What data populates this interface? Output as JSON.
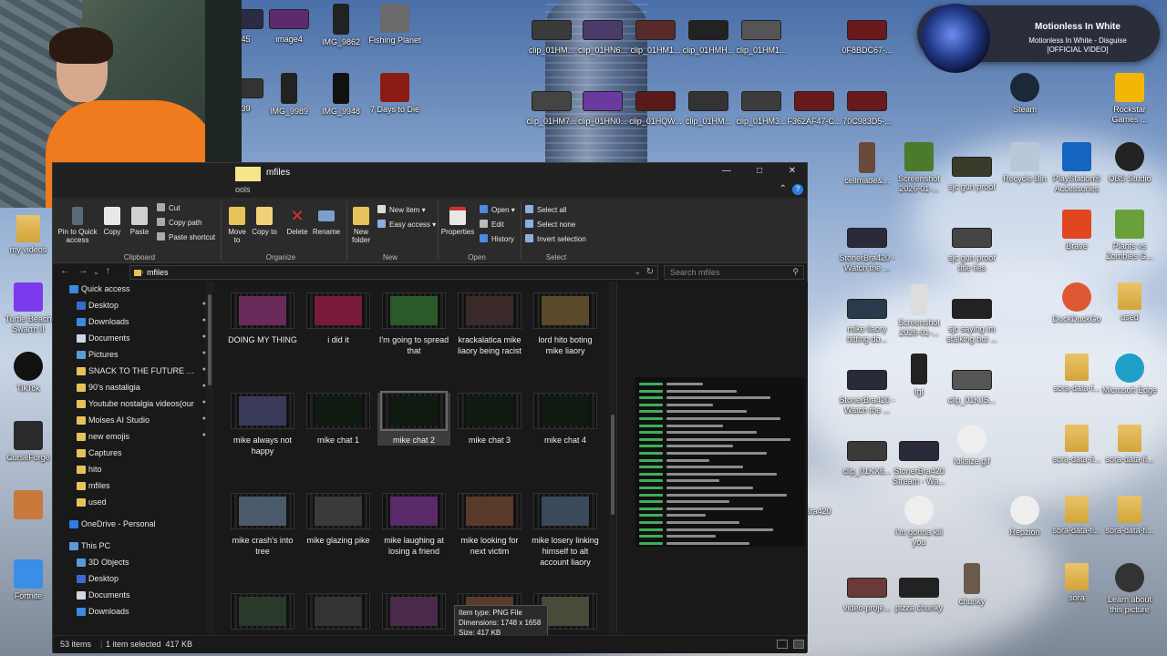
{
  "desktop_icons": [
    {
      "label": "945",
      "kind": "wide",
      "color": "#2b2b44"
    },
    {
      "label": "image4",
      "kind": "wide",
      "color": "#5e2a6e"
    },
    {
      "label": "IMG_9862",
      "kind": "tall",
      "color": "#222"
    },
    {
      "label": "Fishing Planet",
      "kind": "square",
      "color": "#6a6a6a"
    },
    {
      "label": "039",
      "kind": "wide",
      "color": "#333"
    },
    {
      "label": "IMG_9989",
      "kind": "tall",
      "color": "#222"
    },
    {
      "label": "IMG_9948",
      "kind": "tall",
      "color": "#111"
    },
    {
      "label": "7 Days to Die",
      "kind": "square",
      "color": "#8a1c14"
    },
    {
      "label": "clip_01HM...",
      "kind": "wide",
      "color": "#3a3a3a"
    },
    {
      "label": "clip_01HN6...",
      "kind": "wide",
      "color": "#4b3b6a"
    },
    {
      "label": "clip_01HM1...",
      "kind": "wide",
      "color": "#5a2a2a"
    },
    {
      "label": "clip_01HMH...",
      "kind": "wide",
      "color": "#222"
    },
    {
      "label": "clip_01HM1...",
      "kind": "wide",
      "color": "#555"
    },
    {
      "label": "0F8BDC67-...",
      "kind": "wide",
      "color": "#6a1a1a"
    },
    {
      "label": "clip_01HM7...",
      "kind": "wide",
      "color": "#444"
    },
    {
      "label": "clip_01HN0...",
      "kind": "wide",
      "color": "#6a3aa0"
    },
    {
      "label": "clip_01HQW...",
      "kind": "wide",
      "color": "#5a1a1a"
    },
    {
      "label": "clip_01HM...",
      "kind": "wide",
      "color": "#333"
    },
    {
      "label": "clip_01HM3...",
      "kind": "wide",
      "color": "#3c3c3c"
    },
    {
      "label": "F362AF47-C...",
      "kind": "wide",
      "color": "#6a1a1a"
    },
    {
      "label": "70C983D5-...",
      "kind": "wide",
      "color": "#6a1a1a"
    },
    {
      "label": "Steam",
      "kind": "round",
      "color": "#1b2838"
    },
    {
      "label": "Rockstar Games ...",
      "kind": "square",
      "color": "#f2b705"
    },
    {
      "label": "cellmade&...",
      "kind": "tall",
      "color": "#6a4a3a"
    },
    {
      "label": "Screenshot 2026-01-...",
      "kind": "square",
      "color": "#4a7a2a"
    },
    {
      "label": "sjc gun proof",
      "kind": "wide",
      "color": "#3a3a2a"
    },
    {
      "label": "Recycle Bin",
      "kind": "square",
      "color": "#b8c8d8"
    },
    {
      "label": "PlayStation® Accessories",
      "kind": "square",
      "color": "#1565c0"
    },
    {
      "label": "OBS Studio",
      "kind": "round",
      "color": "#222"
    },
    {
      "label": "StonerBra420 - Watch the ...",
      "kind": "wide",
      "color": "#2a2a3a"
    },
    {
      "label": "sjc gun proof title fies",
      "kind": "wide",
      "color": "#444"
    },
    {
      "label": "Brave",
      "kind": "square",
      "color": "#e0461f"
    },
    {
      "label": "Plants vs Zombies G...",
      "kind": "square",
      "color": "#6aa03a"
    },
    {
      "label": "mike liaory hitting do...",
      "kind": "wide",
      "color": "#2a3a4a"
    },
    {
      "label": "Screenshot 2026-01-...",
      "kind": "tall",
      "color": "#ddd"
    },
    {
      "label": "sjc saying im stalking but ...",
      "kind": "wide",
      "color": "#222"
    },
    {
      "label": "DuckDuckGo",
      "kind": "round",
      "color": "#de5833"
    },
    {
      "label": "used",
      "kind": "folder",
      "color": "#e9c46a"
    },
    {
      "label": "StonerBra420 - Watch the ...",
      "kind": "wide",
      "color": "#2a2a3a"
    },
    {
      "label": "fgt",
      "kind": "tall",
      "color": "#222"
    },
    {
      "label": "clip_01KJS...",
      "kind": "wide",
      "color": "#555"
    },
    {
      "label": "sora-data-f...",
      "kind": "folder",
      "color": "#e9c46a"
    },
    {
      "label": "Microsoft Edge",
      "kind": "round",
      "color": "#1ea0c8"
    },
    {
      "label": "clip_01KX6...",
      "kind": "wide",
      "color": "#3a3a3a"
    },
    {
      "label": "StonerBra420 Stream - Wa...",
      "kind": "wide",
      "color": "#2a2a3a"
    },
    {
      "label": "fullsize.gif",
      "kind": "round",
      "color": "#eee"
    },
    {
      "label": "sora-data-fi...",
      "kind": "folder",
      "color": "#e9c46a"
    },
    {
      "label": "sora-data-fi...",
      "kind": "folder",
      "color": "#e9c46a"
    },
    {
      "label": "erBra420",
      "kind": "none",
      "color": "#333"
    },
    {
      "label": "I'm gonna kill you",
      "kind": "round",
      "color": "#eee"
    },
    {
      "label": "Repzion",
      "kind": "round",
      "color": "#eee"
    },
    {
      "label": "sora-data-fi...",
      "kind": "folder",
      "color": "#e9c46a"
    },
    {
      "label": "sora-data-fi...",
      "kind": "folder",
      "color": "#e9c46a"
    },
    {
      "label": "video-proje...",
      "kind": "wide",
      "color": "#6a3a3a"
    },
    {
      "label": "pizza chunky",
      "kind": "wide",
      "color": "#222"
    },
    {
      "label": "chunky",
      "kind": "tall",
      "color": "#6a5a4a"
    },
    {
      "label": "sora",
      "kind": "folder",
      "color": "#e9c46a"
    },
    {
      "label": "Learn about this picture",
      "kind": "round",
      "color": "#333"
    },
    {
      "label": "my videos",
      "kind": "folder",
      "color": "#e9c46a"
    },
    {
      "label": "Turtle Beach Swarm II",
      "kind": "square",
      "color": "#7c3aed"
    },
    {
      "label": "TikTok",
      "kind": "round",
      "color": "#111"
    },
    {
      "label": "CurseForge",
      "kind": "square",
      "color": "#2a2a2a"
    },
    {
      "label": "",
      "kind": "square",
      "color": "#c8783a"
    },
    {
      "label": "Fortnite",
      "kind": "square",
      "color": "#3a8ee6"
    }
  ],
  "now_playing": {
    "title": "Motionless In White",
    "subtitle_line1": "Motionless In White - Disguise",
    "subtitle_line2": "[OFFICIAL VIDEO]"
  },
  "explorer": {
    "title": "mfiles",
    "tools_tab": "ools",
    "ribbon": {
      "pin": "Pin to Quick access",
      "copy": "Copy",
      "paste": "Paste",
      "cut": "Cut",
      "copy_path": "Copy path",
      "paste_shortcut": "Paste shortcut",
      "clipboard": "Clipboard",
      "move_to": "Move to",
      "copy_to": "Copy to",
      "delete": "Delete",
      "rename": "Rename",
      "organize": "Organize",
      "new_folder": "New folder",
      "new_item": "New item",
      "easy_access": "Easy access",
      "new": "New",
      "properties": "Properties",
      "open": "Open",
      "edit": "Edit",
      "history": "History",
      "open_group": "Open",
      "select_all": "Select all",
      "select_none": "Select none",
      "invert_selection": "Invert selection",
      "select": "Select"
    },
    "address": "mfiles",
    "search_placeholder": "Search mfiles",
    "nav": [
      {
        "label": "Quick access",
        "pinned": false
      },
      {
        "label": "Desktop",
        "pinned": true
      },
      {
        "label": "Downloads",
        "pinned": true
      },
      {
        "label": "Documents",
        "pinned": true
      },
      {
        "label": "Pictures",
        "pinned": true
      },
      {
        "label": "SNACK TO THE FUTURE YOU1",
        "pinned": true
      },
      {
        "label": "90's nastaligia",
        "pinned": true
      },
      {
        "label": "Youtube nostalgia videos(our",
        "pinned": true
      },
      {
        "label": "Moises AI Studio",
        "pinned": true
      },
      {
        "label": "new emojis",
        "pinned": true
      },
      {
        "label": "Captures",
        "pinned": false
      },
      {
        "label": "hito",
        "pinned": false
      },
      {
        "label": "mfiles",
        "pinned": false
      },
      {
        "label": "used",
        "pinned": false
      },
      {
        "label": "OneDrive - Personal",
        "pinned": false
      },
      {
        "label": "This PC",
        "pinned": false
      },
      {
        "label": "3D Objects",
        "pinned": false
      },
      {
        "label": "Desktop",
        "pinned": false
      },
      {
        "label": "Documents",
        "pinned": false
      },
      {
        "label": "Downloads",
        "pinned": false
      }
    ],
    "files": [
      {
        "label": "DOING MY THING",
        "color": "#6a2a5a"
      },
      {
        "label": "i did it",
        "color": "#7a1a3a"
      },
      {
        "label": "I'm going to spread that",
        "color": "#2a5a2a"
      },
      {
        "label": "krackalatica mike liaory being racist",
        "color": "#3a2a2a"
      },
      {
        "label": "lord hito boting mike liaory",
        "color": "#5a4a2a"
      },
      {
        "label": "mike always not happy",
        "color": "#3a3a5a"
      },
      {
        "label": "mike chat 1",
        "color": "#0f1a10"
      },
      {
        "label": "mike chat 2",
        "color": "#0f1a10"
      },
      {
        "label": "mike chat 3",
        "color": "#0f1a10"
      },
      {
        "label": "mike chat 4",
        "color": "#0f1a10"
      },
      {
        "label": "mike crash's into tree",
        "color": "#4a5a6a"
      },
      {
        "label": "mike glazing pike",
        "color": "#3a3a3a"
      },
      {
        "label": "mike laughing at losing a friend",
        "color": "#5a2a6a"
      },
      {
        "label": "mike looking for next victim",
        "color": "#5a3a2a"
      },
      {
        "label": "mike losery linking himself to alt account liaory",
        "color": "#3a4a5a"
      },
      {
        "label": "",
        "color": "#2a3a2a"
      },
      {
        "label": "",
        "color": "#333"
      },
      {
        "label": "",
        "color": "#4a2a4a"
      },
      {
        "label": "",
        "color": "#5a3a2a"
      },
      {
        "label": "",
        "color": "#4a4a3a"
      }
    ],
    "tooltip": {
      "line1": "Item type: PNG File",
      "line2": "Dimensions: 1748 x 1658",
      "line3": "Size: 417 KB"
    },
    "status": {
      "items": "53 items",
      "selected": "1 item selected  417 KB"
    }
  }
}
